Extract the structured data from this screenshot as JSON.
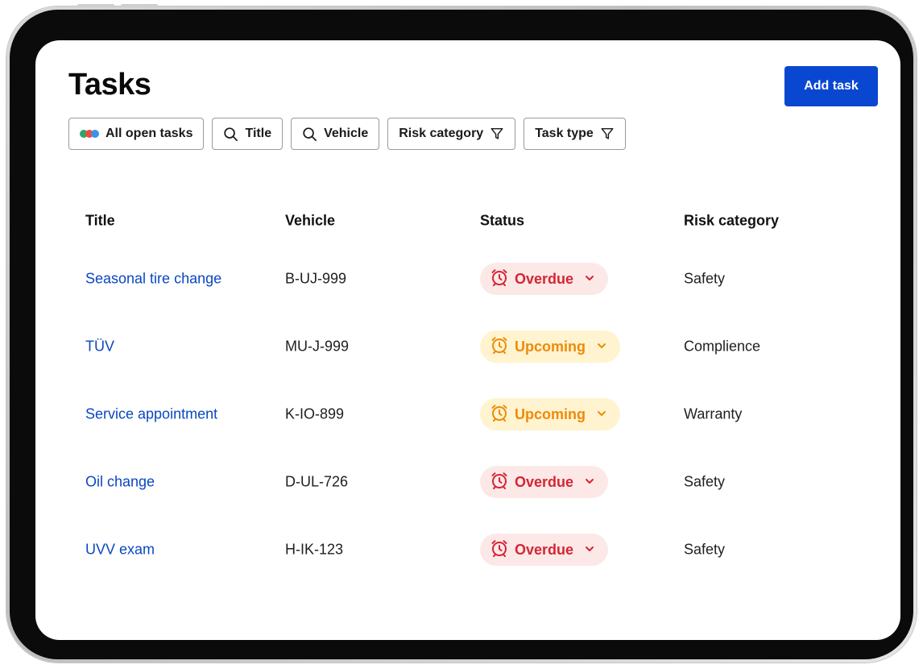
{
  "header": {
    "title": "Tasks",
    "add_task_label": "Add task"
  },
  "filters": [
    {
      "label": "All open tasks",
      "icon": "multicolor-dots-icon"
    },
    {
      "label": "Title",
      "icon": "search-icon"
    },
    {
      "label": "Vehicle",
      "icon": "search-icon"
    },
    {
      "label": "Risk category",
      "icon": "filter-icon"
    },
    {
      "label": "Task type",
      "icon": "filter-icon"
    }
  ],
  "table": {
    "columns": [
      "Title",
      "Vehicle",
      "Status",
      "Risk category"
    ],
    "rows": [
      {
        "title": "Seasonal tire change",
        "vehicle": "B-UJ-999",
        "status": "Overdue",
        "risk": "Safety"
      },
      {
        "title": "TÜV",
        "vehicle": "MU-J-999",
        "status": "Upcoming",
        "risk": "Complience"
      },
      {
        "title": "Service appointment",
        "vehicle": "K-IO-899",
        "status": "Upcoming",
        "risk": "Warranty"
      },
      {
        "title": "Oil change",
        "vehicle": "D-UL-726",
        "status": "Overdue",
        "risk": "Safety"
      },
      {
        "title": "UVV exam",
        "vehicle": "H-IK-123",
        "status": "Overdue",
        "risk": "Safety"
      }
    ]
  },
  "colors": {
    "accent": "#0a47d1",
    "link": "#0a47c2",
    "overdue_text": "#d32633",
    "overdue_bg": "#fde8e8",
    "upcoming_text": "#ef8a08",
    "upcoming_bg": "#fff4cf",
    "dots": [
      "#2ea56b",
      "#f04c3e",
      "#3d8ff0"
    ]
  }
}
